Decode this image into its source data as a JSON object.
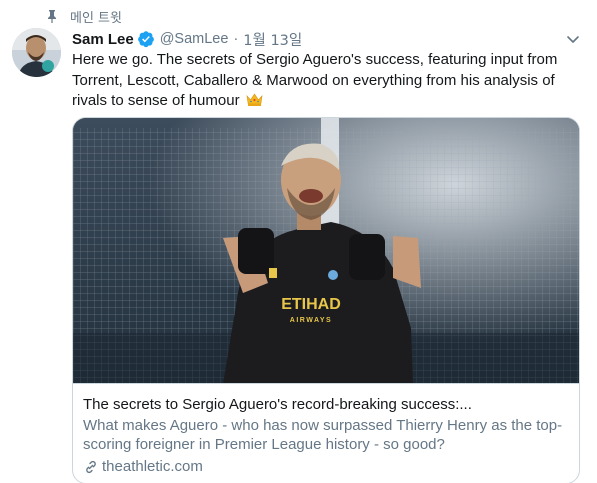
{
  "pinned": {
    "label": "메인 트윗",
    "icon": "pin-icon"
  },
  "author": {
    "name": "Sam Lee",
    "verified": true,
    "handle": "@SamLee",
    "separator": "·",
    "date": "1월 13일",
    "avatar_icon": "avatar",
    "verified_icon": "verified-badge-icon"
  },
  "tweet": {
    "text": "Here we go. The secrets of Sergio Aguero's success, featuring input from Torrent, Lescott, Caballero & Marwood  on everything from his analysis of rivals to sense of humour",
    "emoji": "crown-icon"
  },
  "card": {
    "image_alt": "Sergio Aguero celebrating in a black Manchester City kit",
    "shirt_sponsor": "ETIHAD",
    "shirt_sponsor_sub": "AIRWAYS",
    "title": "The secrets to Sergio Aguero's record-breaking success:...",
    "description": "What makes Aguero - who has now surpassed Thierry Henry as the top-scoring foreigner in Premier League history - so good?",
    "domain": "theathletic.com"
  },
  "colors": {
    "text_primary": "#14171a",
    "text_secondary": "#657786",
    "verified_blue": "#1da1f2",
    "border": "#ccd6dd"
  }
}
